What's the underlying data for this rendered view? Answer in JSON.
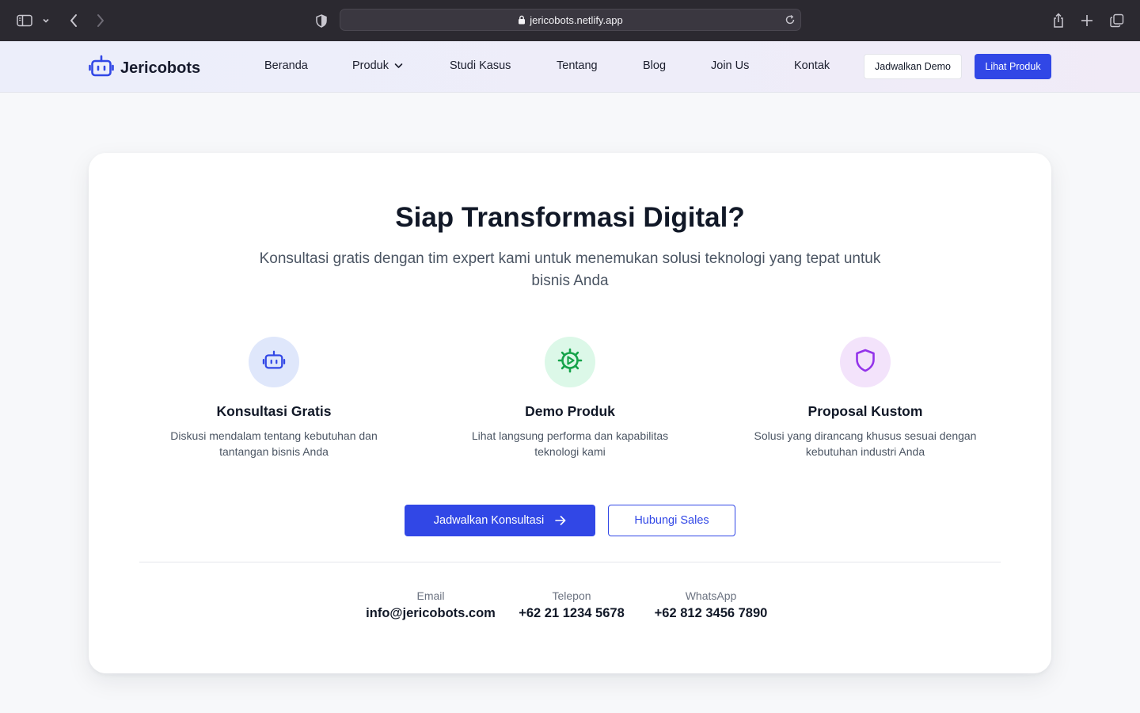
{
  "browser": {
    "url": "jericobots.netlify.app"
  },
  "site": {
    "brand": "Jericobots",
    "nav": [
      {
        "label": "Beranda"
      },
      {
        "label": "Produk"
      },
      {
        "label": "Studi Kasus"
      },
      {
        "label": "Tentang"
      },
      {
        "label": "Blog"
      },
      {
        "label": "Join Us"
      },
      {
        "label": "Kontak"
      }
    ],
    "demo_button": "Jadwalkan Demo",
    "product_button": "Lihat Produk"
  },
  "cta": {
    "title": "Siap Transformasi Digital?",
    "subtitle": "Konsultasi gratis dengan tim expert kami untuk menemukan solusi teknologi yang tepat untuk bisnis Anda",
    "features": [
      {
        "icon": "robot-icon",
        "title": "Konsultasi Gratis",
        "description": "Diskusi mendalam tentang kebutuhan dan tantangan bisnis Anda",
        "color": "#3147e6",
        "bg": "#dfe7fb"
      },
      {
        "icon": "gear-play-icon",
        "title": "Demo Produk",
        "description": "Lihat langsung performa dan kapabilitas teknologi kami",
        "color": "#16a34a",
        "bg": "#dcf8e8"
      },
      {
        "icon": "shield-icon",
        "title": "Proposal Kustom",
        "description": "Solusi yang dirancang khusus sesuai dengan kebutuhan industri Anda",
        "color": "#9333ea",
        "bg": "#f3e3fb"
      }
    ],
    "primary_button": "Jadwalkan Konsultasi",
    "secondary_button": "Hubungi Sales",
    "contacts": [
      {
        "label": "Email",
        "value": "info@jericobots.com"
      },
      {
        "label": "Telepon",
        "value": "+62 21 1234 5678"
      },
      {
        "label": "WhatsApp",
        "value": "+62 812 3456 7890"
      }
    ]
  },
  "colors": {
    "accent": "#3147e6",
    "browser_chrome": "#2b2930",
    "page_bg": "#f7f8fa"
  }
}
